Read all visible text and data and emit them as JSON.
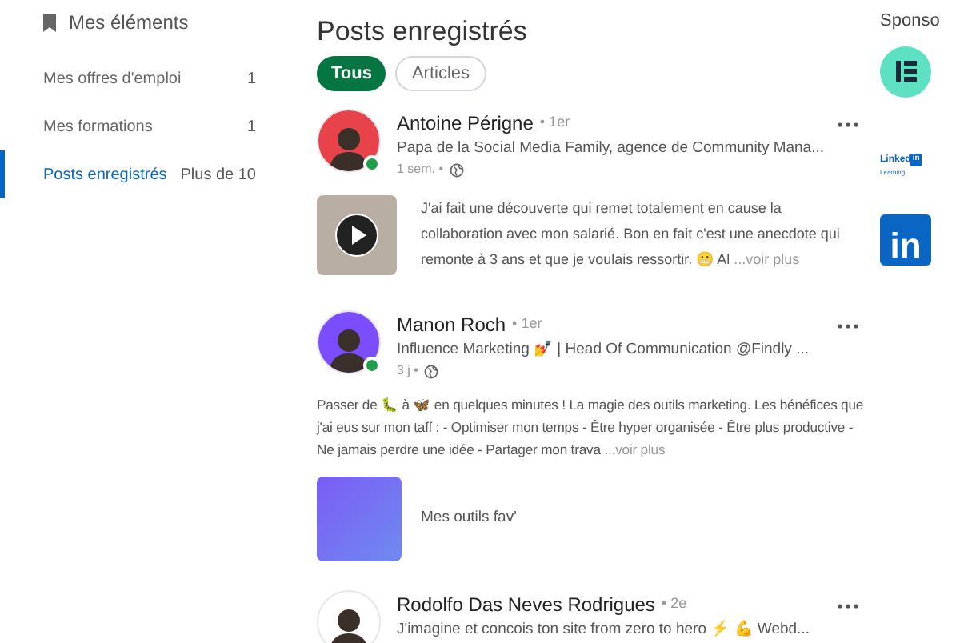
{
  "sidebar": {
    "title": "Mes éléments",
    "items": [
      {
        "label": "Mes offres d'emploi",
        "count": "1",
        "selected": false
      },
      {
        "label": "Mes formations",
        "count": "1",
        "selected": false
      },
      {
        "label": "Posts enregistrés",
        "count": "Plus de 10",
        "selected": true
      }
    ]
  },
  "main": {
    "title": "Posts enregistrés",
    "filters": [
      {
        "label": "Tous",
        "selected": true
      },
      {
        "label": "Articles",
        "selected": false
      }
    ],
    "posts": [
      {
        "author": "Antoine Périgne",
        "degree": "• 1er",
        "headline": "Papa de la Social Media Family, agence de Community Mana...",
        "time": "1 sem. •",
        "online": true,
        "attachment": {
          "kind": "video"
        },
        "text": "J'ai fait une découverte qui remet totalement en cause la collaboration avec mon salarié. Bon en fait c'est une anecdote qui remonte à 3 ans et que je voulais ressortir. 😬 Al",
        "more": "...voir plus"
      },
      {
        "author": "Manon Roch",
        "degree": "• 1er",
        "headline": "Influence Marketing 💅 | Head Of Communication @Findly ...",
        "time": "3 j •",
        "online": true,
        "text": "Passer de 🐛 à 🦋 en quelques minutes ! La magie des outils marketing. Les bénéfices que j'ai eus sur mon taff : - Optimiser mon temps - Être hyper organisée - Être plus productive - Ne jamais perdre une idée - Partager mon trava",
        "more": "...voir plus",
        "attachment": {
          "kind": "image",
          "caption": "Mes outils fav'"
        }
      },
      {
        "author": "Rodolfo Das Neves Rodrigues",
        "degree": "• 2e",
        "headline": "J'imagine et concois ton site from zero to hero ⚡ 💪 Webd...",
        "online": false
      }
    ]
  },
  "sponsored": {
    "title": "Sponso",
    "items": [
      {
        "kind": "circle"
      },
      {
        "kind": "learning",
        "word": "Linked",
        "badge": "in",
        "sub": "Learning"
      },
      {
        "kind": "square",
        "badge": "in"
      }
    ]
  }
}
